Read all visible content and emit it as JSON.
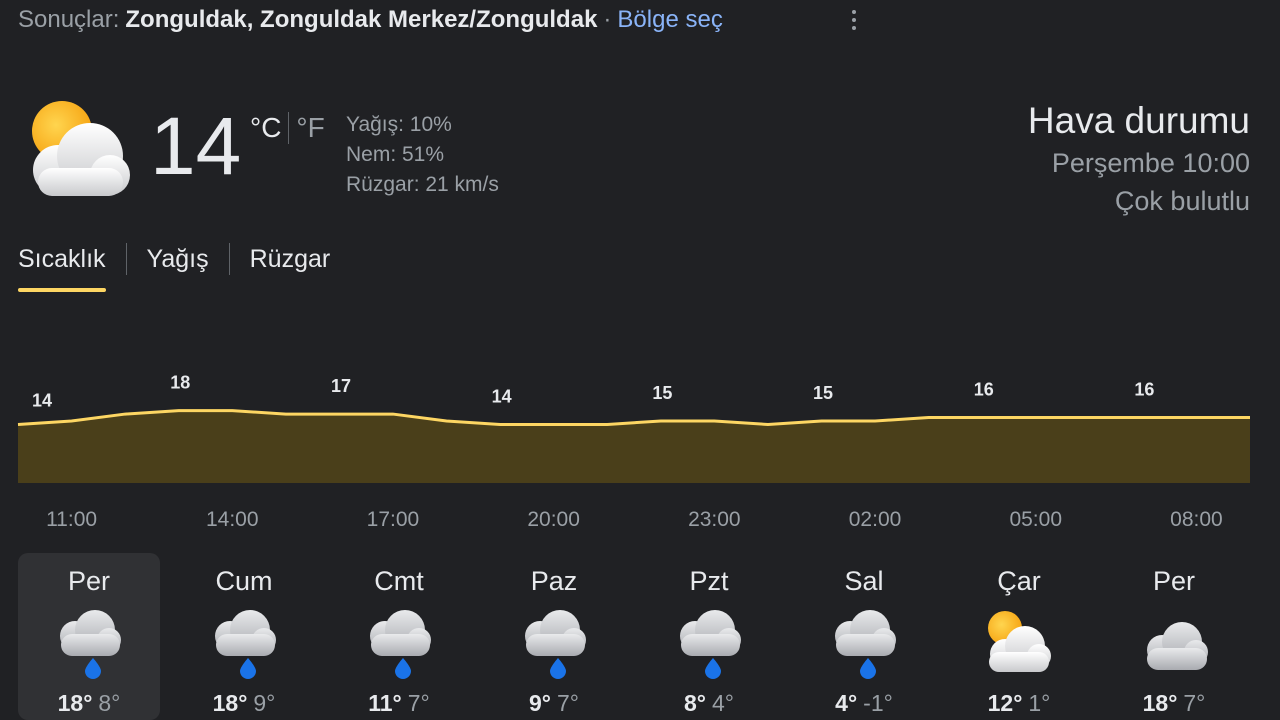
{
  "header": {
    "results_label": "Sonuçlar:",
    "location": "Zonguldak, Zonguldak Merkez/Zonguldak",
    "separator": "·",
    "select_region": "Bölge seç",
    "more_icon": "more-vert-icon"
  },
  "current": {
    "icon": "partly-cloudy-icon",
    "temperature": "14",
    "unit_c": "°C",
    "unit_f": "°F",
    "precipitation": "Yağış: 10%",
    "humidity": "Nem: 51%",
    "wind": "Rüzgar: 21 km/s",
    "title": "Hava durumu",
    "datetime": "Perşembe 10:00",
    "condition": "Çok bulutlu"
  },
  "tabs": [
    {
      "label": "Sıcaklık",
      "active": true
    },
    {
      "label": "Yağış",
      "active": false
    },
    {
      "label": "Rüzgar",
      "active": false
    }
  ],
  "chart_data": {
    "type": "area",
    "times": [
      "10:00",
      "11:00",
      "12:00",
      "13:00",
      "14:00",
      "15:00",
      "16:00",
      "17:00",
      "18:00",
      "19:00",
      "20:00",
      "21:00",
      "22:00",
      "23:00",
      "00:00",
      "01:00",
      "02:00",
      "03:00",
      "04:00",
      "05:00",
      "06:00",
      "07:00",
      "08:00",
      "09:00"
    ],
    "values": [
      14,
      15,
      17,
      18,
      18,
      17,
      17,
      17,
      15,
      14,
      14,
      14,
      15,
      15,
      14,
      15,
      15,
      16,
      16,
      16,
      16,
      16,
      16,
      16
    ],
    "tick_labels": [
      "11:00",
      "14:00",
      "17:00",
      "20:00",
      "23:00",
      "02:00",
      "05:00",
      "08:00"
    ],
    "label_hours": [
      "11:00",
      "14:00",
      "17:00",
      "20:00",
      "23:00",
      "02:00",
      "05:00",
      "08:00"
    ],
    "label_values": [
      "18",
      "17",
      "14",
      "15",
      "15",
      "16",
      "16"
    ],
    "first_label": "14",
    "ylim": [
      0,
      22
    ],
    "line_color": "#fdd663",
    "fill_color": "#4a3f1a"
  },
  "days": [
    {
      "name": "Per",
      "icon": "rain-cloud-icon",
      "high": "18°",
      "low": "8°",
      "selected": true
    },
    {
      "name": "Cum",
      "icon": "rain-cloud-icon",
      "high": "18°",
      "low": "9°",
      "selected": false
    },
    {
      "name": "Cmt",
      "icon": "rain-cloud-icon",
      "high": "11°",
      "low": "7°",
      "selected": false
    },
    {
      "name": "Paz",
      "icon": "rain-cloud-icon",
      "high": "9°",
      "low": "7°",
      "selected": false
    },
    {
      "name": "Pzt",
      "icon": "rain-cloud-icon",
      "high": "8°",
      "low": "4°",
      "selected": false
    },
    {
      "name": "Sal",
      "icon": "rain-cloud-icon",
      "high": "4°",
      "low": "-1°",
      "selected": false
    },
    {
      "name": "Çar",
      "icon": "partly-cloudy-icon",
      "high": "12°",
      "low": "1°",
      "selected": false
    },
    {
      "name": "Per",
      "icon": "cloud-icon",
      "high": "18°",
      "low": "7°",
      "selected": false
    }
  ],
  "colors": {
    "background": "#202124",
    "accent": "#fdd663",
    "link": "#8ab4f8",
    "rain_drop": "#1a73e8",
    "sun": "#f9a825"
  }
}
